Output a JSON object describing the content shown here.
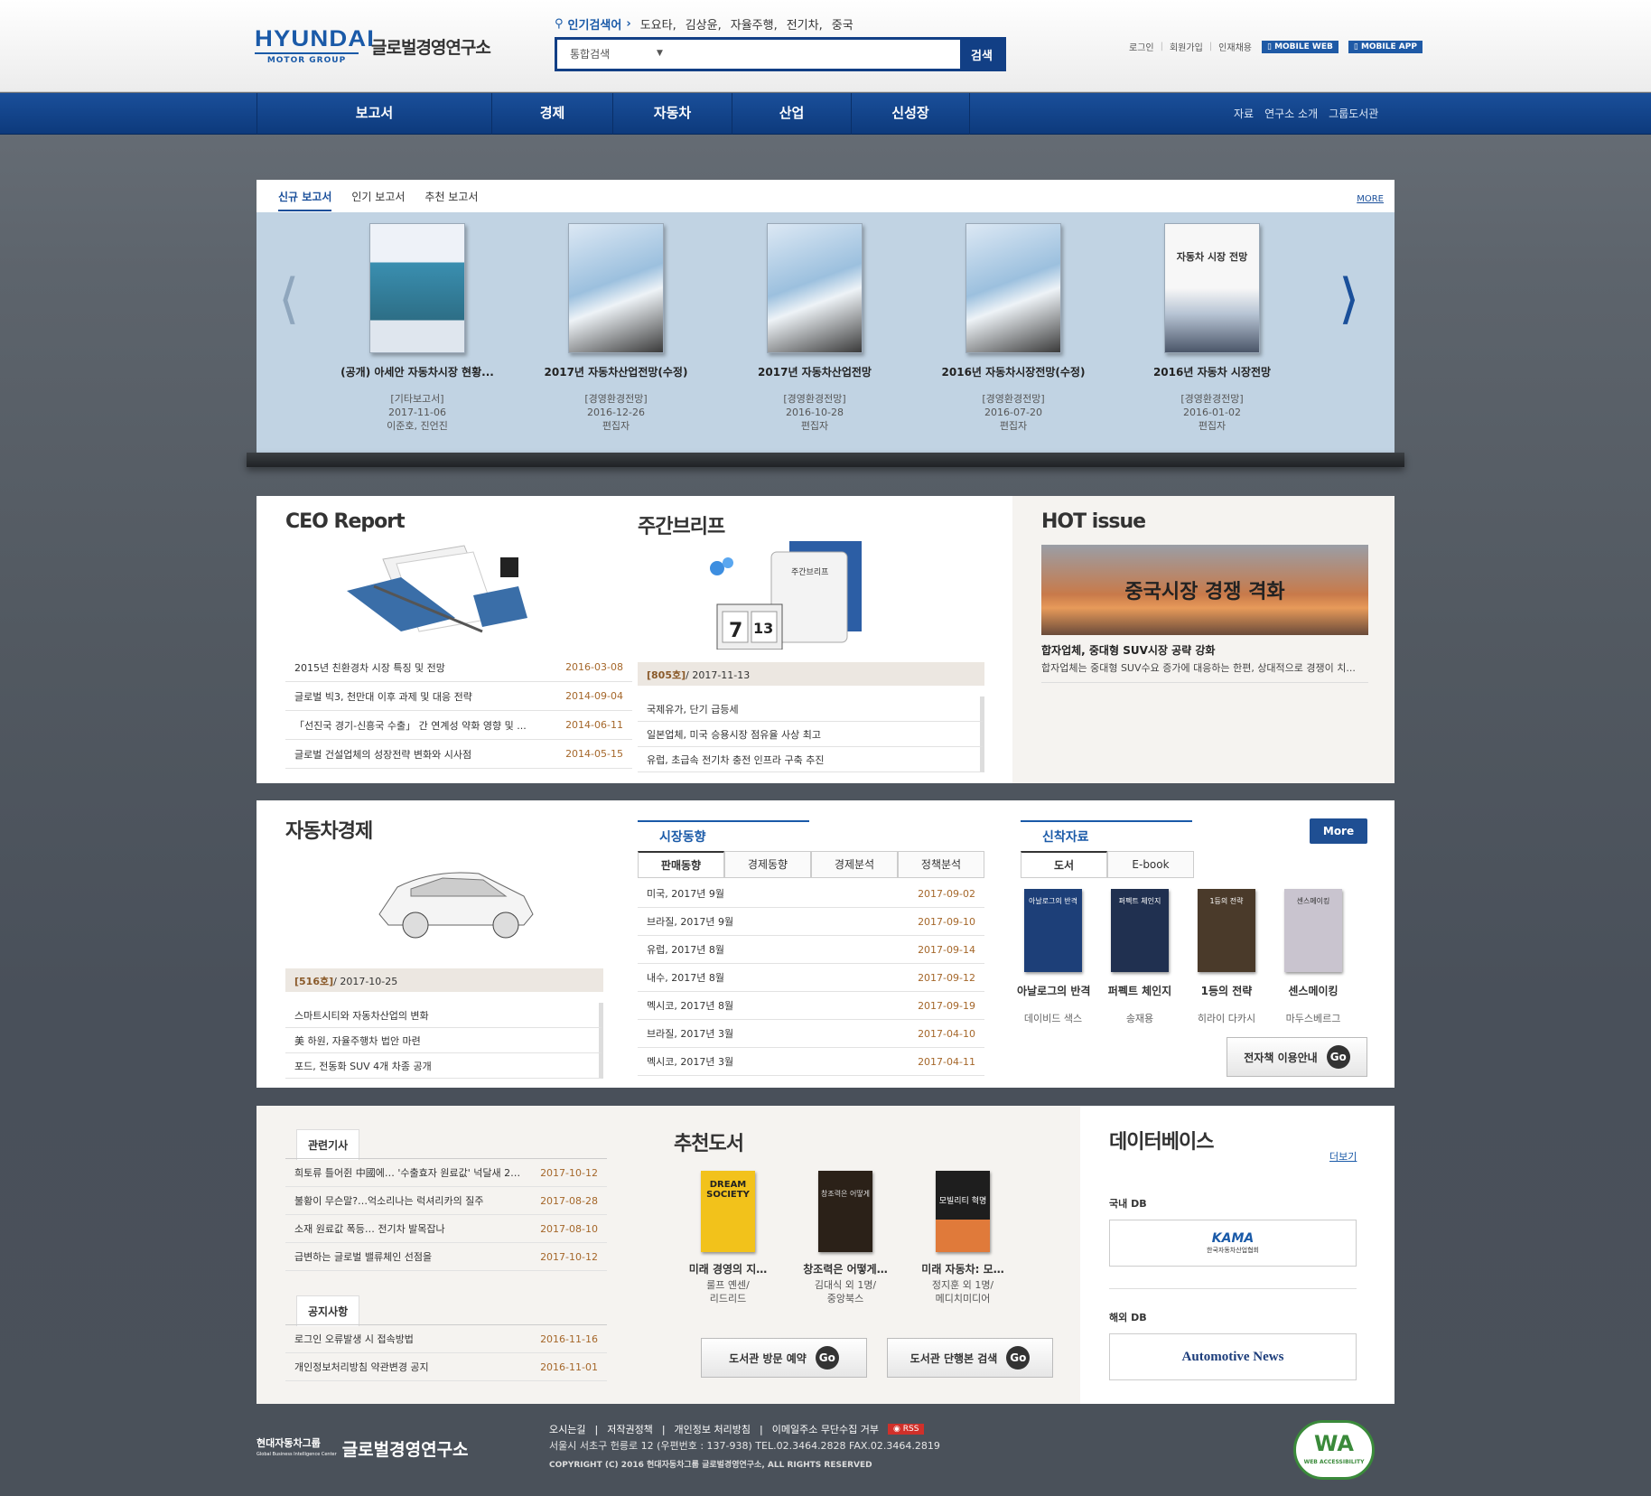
{
  "header": {
    "logo_top": "HYUNDAI",
    "logo_bottom": "MOTOR GROUP",
    "site_name": "글로벌경영연구소",
    "popular_label": "인기검색어",
    "popular_terms": [
      "도요타,",
      "김상윤,",
      "자율주행,",
      "전기차,",
      "중국"
    ],
    "search_select": "통합검색",
    "search_button": "검색",
    "util": [
      "로그인",
      "회원가입",
      "인재채용"
    ],
    "mobile_web": "MOBILE WEB",
    "mobile_app": "MOBILE APP"
  },
  "gnb": {
    "items": [
      "보고서",
      "경제",
      "자동차",
      "산업",
      "신성장"
    ],
    "sub": [
      "자료",
      "연구소 소개",
      "그룹도서관"
    ]
  },
  "reports": {
    "tabs": [
      "신규 보고서",
      "인기 보고서",
      "추천 보고서"
    ],
    "more": "MORE",
    "items": [
      {
        "title": "(공개) 아세안 자동차시장 현황...",
        "cat": "[기타보고서]",
        "date": "2017-11-06",
        "author": "이준호, 진언진"
      },
      {
        "title": "2017년 자동차산업전망(수정)",
        "cat": "[경영환경전망]",
        "date": "2016-12-26",
        "author": "편집자"
      },
      {
        "title": "2017년 자동차산업전망",
        "cat": "[경영환경전망]",
        "date": "2016-10-28",
        "author": "편집자"
      },
      {
        "title": "2016년 자동차시장전망(수정)",
        "cat": "[경영환경전망]",
        "date": "2016-07-20",
        "author": "편집자"
      },
      {
        "title": "2016년 자동차 시장전망",
        "cat": "[경영환경전망]",
        "date": "2016-01-02",
        "author": "편집자",
        "cover_title": "자동차 시장 전망"
      }
    ]
  },
  "ceo": {
    "title": "CEO Report",
    "rows": [
      {
        "t": "2015년 친환경차 시장 특징 및 전망",
        "d": "2016-03-08"
      },
      {
        "t": "글로벌 빅3, 천만대 이후 과제 및 대응 전략",
        "d": "2014-09-04"
      },
      {
        "t": "「선진국 경기-신흥국 수출」 간 연계성 약화 영향 및 ...",
        "d": "2014-06-11"
      },
      {
        "t": "글로벌 건설업체의 성장전략 변화와 시사점",
        "d": "2014-05-15"
      }
    ]
  },
  "weekly": {
    "title": "주간브리프",
    "cover_label": "주간브리프",
    "issue": "[805호]",
    "issue_date": "/ 2017-11-13",
    "cal": "7",
    "cal2": "13",
    "rows": [
      "국제유가, 단기 급등세",
      "일본업체, 미국 승용시장 점유율 사상 최고",
      "유럽, 초급속 전기차 충전 인프라 구축 추진"
    ]
  },
  "hot": {
    "title": "HOT issue",
    "banner": "중국시장 경쟁 격화",
    "headline": "합자업체, 중대형 SUV시장 공략 강화",
    "desc": "합자업체는 중대형 SUV수요 증가에 대응하는 한편, 상대적으로 경쟁이 치..."
  },
  "auto": {
    "title": "자동차경제",
    "issue": "[516호]",
    "issue_date": "/ 2017-10-25",
    "rows": [
      "스마트시티와 자동차산업의 변화",
      "美 하원, 자율주행차 법안 마련",
      "포드, 전동화 SUV 4개 차종 공개"
    ]
  },
  "market": {
    "label": "시장동향",
    "tabs": [
      "판매동향",
      "경제동향",
      "경제분석",
      "정책분석"
    ],
    "rows": [
      {
        "t": "미국, 2017년 9월",
        "d": "2017-09-02"
      },
      {
        "t": "브라질, 2017년 9월",
        "d": "2017-09-10"
      },
      {
        "t": "유럽, 2017년 8월",
        "d": "2017-09-14"
      },
      {
        "t": "내수, 2017년 8월",
        "d": "2017-09-12"
      },
      {
        "t": "멕시코, 2017년 8월",
        "d": "2017-09-19"
      },
      {
        "t": "브라질, 2017년 3월",
        "d": "2017-04-10"
      },
      {
        "t": "멕시코, 2017년 3월",
        "d": "2017-04-11"
      }
    ]
  },
  "newbooks": {
    "label": "신착자료",
    "tabs": [
      "도서",
      "E-book"
    ],
    "more": "More",
    "items": [
      {
        "t": "아날로그의 반격",
        "a": "데이비드 색스",
        "color": "#1d3f78",
        "cover": "아날로그의 반격"
      },
      {
        "t": "퍼펙트 체인지",
        "a": "송재용",
        "color": "#203050",
        "cover": "퍼펙트 체인지"
      },
      {
        "t": "1등의 전략",
        "a": "히라이 다카시",
        "color": "#4a3a2a",
        "cover": "1등의 전략"
      },
      {
        "t": "센스메이킹",
        "a": "마두스베르그",
        "color": "#c9c4cf",
        "cover": "센스메이킹"
      }
    ],
    "ebook_guide": "전자책 이용안내",
    "go": "Go"
  },
  "related": {
    "label": "관련기사",
    "rows": [
      {
        "t": "희토류 틀어쥔 中國에… '수출효자 원료값' 넉달새 2…",
        "d": "2017-10-12"
      },
      {
        "t": "불황이 무슨말?…억소리나는 럭셔리카의 질주",
        "d": "2017-08-28"
      },
      {
        "t": "소재 원료값 폭등… 전기차 발목잡나",
        "d": "2017-08-10"
      },
      {
        "t": "급변하는 글로벌 밸류체인 선점을",
        "d": "2017-10-12"
      }
    ]
  },
  "notice": {
    "label": "공지사항",
    "rows": [
      {
        "t": "로그인 오류발생 시 접속방법",
        "d": "2016-11-16"
      },
      {
        "t": "개인정보처리방침 약관변경 공지",
        "d": "2016-11-01"
      }
    ]
  },
  "recommend": {
    "title": "추천도서",
    "items": [
      {
        "t": "미래 경영의 지…",
        "a1": "룰프 옌센/",
        "a2": "리드리드",
        "color": "#f2c21b",
        "cover": "DREAM SOCIETY"
      },
      {
        "t": "창조력은 어떻게…",
        "a1": "김대식 외 1명/",
        "a2": "중앙북스",
        "color": "#2b2118",
        "cover": "창조력은 어떻게"
      },
      {
        "t": "미래 자동차: 모…",
        "a1": "정지훈 외 1명/",
        "a2": "메디치미디어",
        "color": "#1e1e1e",
        "cover": "모빌리티 혁명"
      }
    ],
    "visit": "도서관 방문 예약",
    "search": "도서관 단행본 검색"
  },
  "database": {
    "title": "데이터베이스",
    "more": "더보기",
    "domestic": "국내 DB",
    "overseas": "해외 DB",
    "kama": "KAMA",
    "kama_sub": "한국자동차산업협회",
    "an": "Automotive News"
  },
  "footer": {
    "brand_small": "현대자동차그룹",
    "brand_en": "Global Business Intelligence Center",
    "brand": "글로벌경영연구소",
    "links": [
      "오시는길",
      "저작권정책",
      "개인정보 처리방침",
      "이메일주소 무단수집 거부"
    ],
    "rss": "RSS",
    "addr": "서울시 서초구 헌릉로 12 (우편번호 : 137-938)   TEL.02.3464.2828   FAX.02.3464.2819",
    "copy": "COPYRIGHT (C) 2016 현대자동차그룹 글로벌경영연구소, ALL RIGHTS RESERVED",
    "wa": "WA",
    "wa_sub": "WEB ACCESSIBILITY"
  }
}
